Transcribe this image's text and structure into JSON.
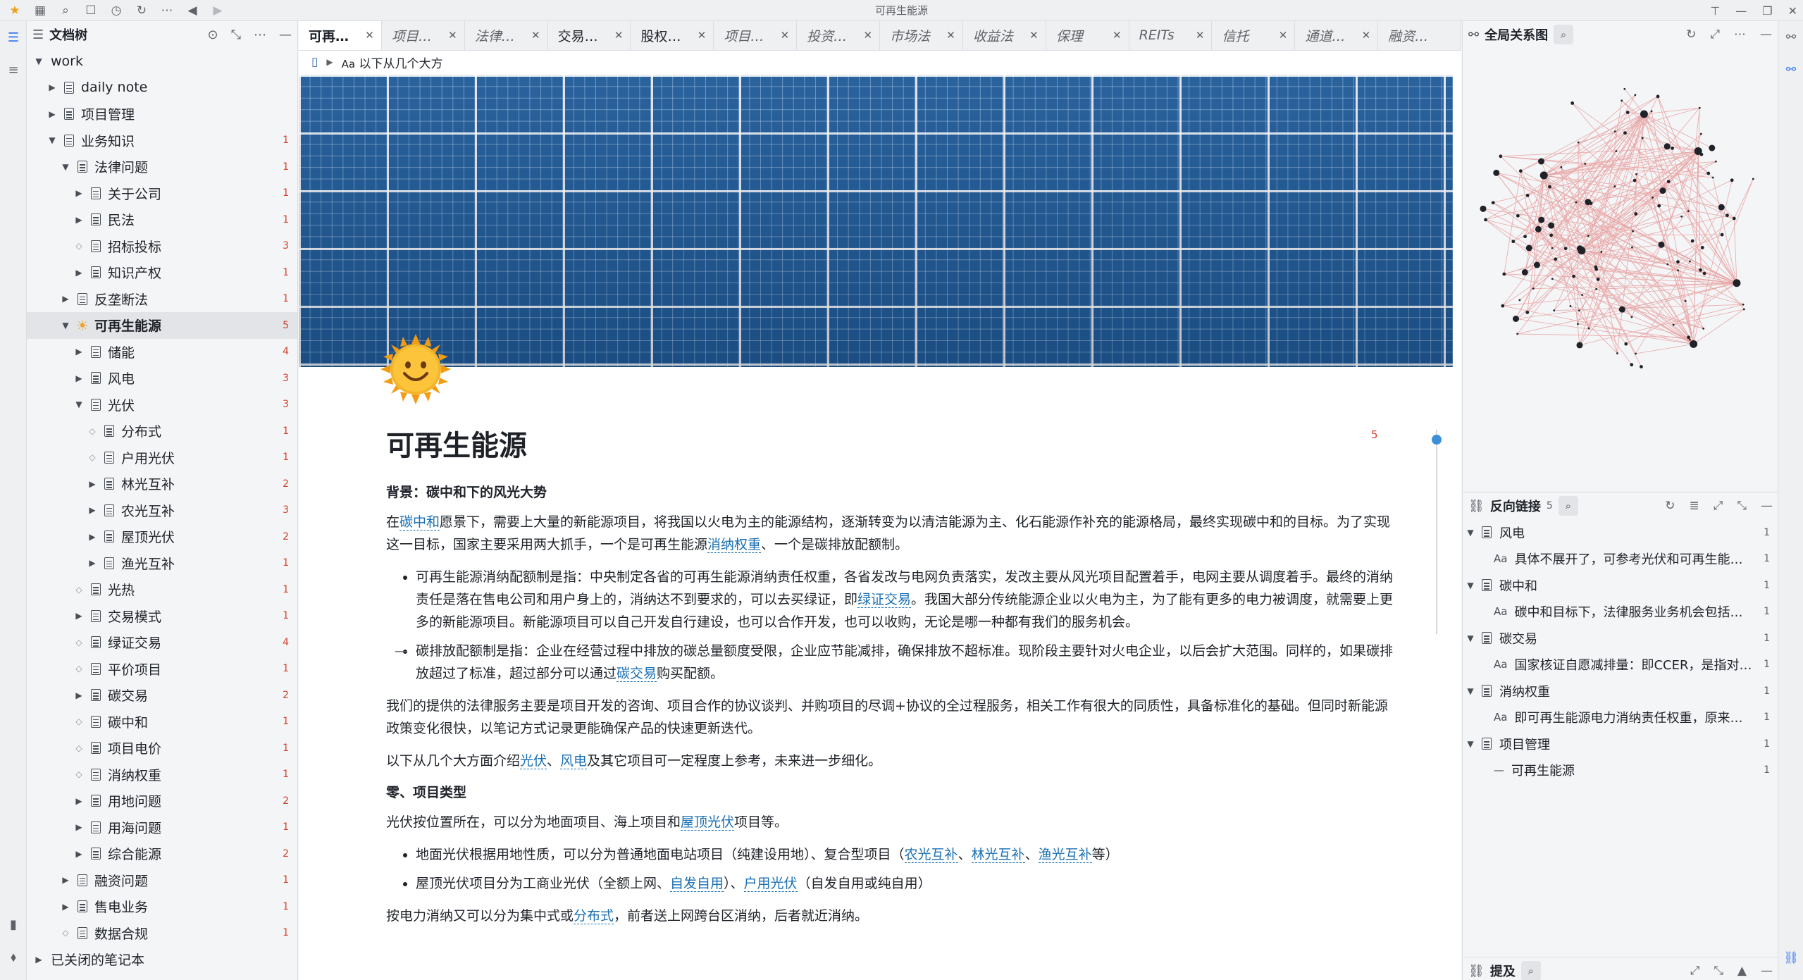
{
  "window": {
    "title": "可再生能源"
  },
  "titlebar_icons": [
    "app-logo-icon",
    "calendar-icon",
    "search-icon",
    "square-icon",
    "history-icon",
    "refresh-icon",
    "more-icon",
    "back-icon",
    "forward-icon"
  ],
  "colors": {
    "accent": "#3575f0",
    "count": "#d2412a",
    "link": "#1a6fb3",
    "banner": "#1f5a98"
  },
  "filetree": {
    "title": "文档树",
    "rows": [
      {
        "label": "work",
        "level": 0,
        "toggle": "open",
        "icon": "none",
        "count": ""
      },
      {
        "label": "daily note",
        "level": 1,
        "toggle": "closed",
        "icon": "doc",
        "count": ""
      },
      {
        "label": "项目管理",
        "level": 1,
        "toggle": "closed",
        "icon": "doc",
        "count": ""
      },
      {
        "label": "业务知识",
        "level": 1,
        "toggle": "open",
        "icon": "doc",
        "count": "1"
      },
      {
        "label": "法律问题",
        "level": 2,
        "toggle": "open",
        "icon": "doc",
        "count": "1"
      },
      {
        "label": "关于公司",
        "level": 3,
        "toggle": "closed",
        "icon": "doc",
        "count": "1"
      },
      {
        "label": "民法",
        "level": 3,
        "toggle": "closed",
        "icon": "doc",
        "count": "1"
      },
      {
        "label": "招标投标",
        "level": 3,
        "toggle": "leaf",
        "icon": "doc",
        "count": "3"
      },
      {
        "label": "知识产权",
        "level": 3,
        "toggle": "closed",
        "icon": "doc",
        "count": "1"
      },
      {
        "label": "反垄断法",
        "level": 2,
        "toggle": "closed",
        "icon": "doc",
        "count": "1"
      },
      {
        "label": "可再生能源",
        "level": 2,
        "toggle": "open",
        "icon": "sun",
        "count": "5",
        "selected": true
      },
      {
        "label": "储能",
        "level": 3,
        "toggle": "closed",
        "icon": "doc",
        "count": "4"
      },
      {
        "label": "风电",
        "level": 3,
        "toggle": "closed",
        "icon": "doc",
        "count": "3"
      },
      {
        "label": "光伏",
        "level": 3,
        "toggle": "open",
        "icon": "doc",
        "count": "3"
      },
      {
        "label": "分布式",
        "level": 4,
        "toggle": "leaf",
        "icon": "doc",
        "count": "1"
      },
      {
        "label": "户用光伏",
        "level": 4,
        "toggle": "leaf",
        "icon": "doc",
        "count": "1"
      },
      {
        "label": "林光互补",
        "level": 4,
        "toggle": "closed",
        "icon": "doc",
        "count": "2"
      },
      {
        "label": "农光互补",
        "level": 4,
        "toggle": "closed",
        "icon": "doc",
        "count": "3"
      },
      {
        "label": "屋顶光伏",
        "level": 4,
        "toggle": "closed",
        "icon": "doc",
        "count": "2"
      },
      {
        "label": "渔光互补",
        "level": 4,
        "toggle": "closed",
        "icon": "doc",
        "count": "1"
      },
      {
        "label": "光热",
        "level": 3,
        "toggle": "leaf",
        "icon": "doc",
        "count": "1"
      },
      {
        "label": "交易模式",
        "level": 3,
        "toggle": "closed",
        "icon": "doc",
        "count": "1"
      },
      {
        "label": "绿证交易",
        "level": 3,
        "toggle": "leaf",
        "icon": "doc",
        "count": "4"
      },
      {
        "label": "平价项目",
        "level": 3,
        "toggle": "leaf",
        "icon": "doc",
        "count": "1"
      },
      {
        "label": "碳交易",
        "level": 3,
        "toggle": "closed",
        "icon": "doc",
        "count": "2"
      },
      {
        "label": "碳中和",
        "level": 3,
        "toggle": "leaf",
        "icon": "doc",
        "count": "1"
      },
      {
        "label": "项目电价",
        "level": 3,
        "toggle": "leaf",
        "icon": "doc",
        "count": "1"
      },
      {
        "label": "消纳权重",
        "level": 3,
        "toggle": "leaf",
        "icon": "doc",
        "count": "1"
      },
      {
        "label": "用地问题",
        "level": 3,
        "toggle": "closed",
        "icon": "doc",
        "count": "2"
      },
      {
        "label": "用海问题",
        "level": 3,
        "toggle": "closed",
        "icon": "doc",
        "count": "1"
      },
      {
        "label": "综合能源",
        "level": 3,
        "toggle": "closed",
        "icon": "doc",
        "count": "2"
      },
      {
        "label": "融资问题",
        "level": 2,
        "toggle": "closed",
        "icon": "doc",
        "count": "1"
      },
      {
        "label": "售电业务",
        "level": 2,
        "toggle": "closed",
        "icon": "doc",
        "count": "1"
      },
      {
        "label": "数据合规",
        "level": 2,
        "toggle": "leaf",
        "icon": "doc",
        "count": "1"
      },
      {
        "label": "已关闭的笔记本",
        "level": 0,
        "toggle": "closed",
        "icon": "none",
        "count": ""
      }
    ]
  },
  "tabs": [
    {
      "label": "可再…",
      "active": true,
      "italic": false
    },
    {
      "label": "项目…",
      "active": false,
      "italic": true
    },
    {
      "label": "法律…",
      "active": false,
      "italic": true
    },
    {
      "label": "交易…",
      "active": false,
      "italic": false
    },
    {
      "label": "股权…",
      "active": false,
      "italic": false
    },
    {
      "label": "项目…",
      "active": false,
      "italic": true
    },
    {
      "label": "投资…",
      "active": false,
      "italic": true
    },
    {
      "label": "市场法",
      "active": false,
      "italic": true
    },
    {
      "label": "收益法",
      "active": false,
      "italic": true
    },
    {
      "label": "保理",
      "active": false,
      "italic": true
    },
    {
      "label": "REITs",
      "active": false,
      "italic": true
    },
    {
      "label": "信托",
      "active": false,
      "italic": true
    },
    {
      "label": "通道…",
      "active": false,
      "italic": true
    },
    {
      "label": "融资…",
      "active": false,
      "italic": true
    }
  ],
  "breadcrumb": {
    "text": "以下从几个大方",
    "prefix": "Aa"
  },
  "doc": {
    "title": "可再生能源",
    "backlink_count": "5",
    "bg_heading": "背景：碳中和下的风光大势",
    "p1": {
      "a": "在",
      "l1": "碳中和",
      "b": "愿景下，需要上大量的新能源项目，将我国以火电为主的能源结构，逐渐转变为以清洁能源为主、化石能源作补充的能源格局，最终实现碳中和的目标。为了实现这一目标，国家主要采用两大抓手，一个是可再生能源",
      "l2": "消纳权重",
      "c": "、一个是碳排放配额制。"
    },
    "li1": {
      "a": "可再生能源消纳配额制是指：中央制定各省的可再生能源消纳责任权重，各省发改与电网负责落实，发改主要从风光项目配置着手，电网主要从调度着手。最终的消纳责任是落在售电公司和用户身上的，消纳达不到要求的，可以去买绿证，即",
      "l1": "绿证交易",
      "b": "。我国大部分传统能源企业以火电为主，为了能有更多的电力被调度，就需要上更多的新能源项目。新能源项目可以自己开发自行建设，也可以合作开发，也可以收购，无论是哪一种都有我们的服务机会。"
    },
    "li2": {
      "a": "碳排放配额制是指：企业在经营过程中排放的碳总量额度受限，企业应节能减排，确保排放不超标准。现阶段主要针对火电企业，以后会扩大范围。同样的，如果碳排放超过了标准，超过部分可以通过",
      "l1": "碳交易",
      "b": "购买配额。"
    },
    "p2": "我们的提供的法律服务主要是项目开发的咨询、项目合作的协议谈判、并购项目的尽调+协议的全过程服务，相关工作有很大的同质性，具备标准化的基础。但同时新能源政策变化很快，以笔记方式记录更能确保产品的快速更新迭代。",
    "p3": {
      "a": "以下从几个大方面介绍",
      "l1": "光伏",
      "b": "、",
      "l2": "风电",
      "c": "及其它项目可一定程度上参考，未来进一步细化。"
    },
    "h_types": "零、项目类型",
    "p4": {
      "a": "光伏按位置所在，可以分为地面项目、海上项目和",
      "l1": "屋顶光伏",
      "b": "项目等。"
    },
    "li3": {
      "a": "地面光伏根据用地性质，可以分为普通地面电站项目（纯建设用地）、复合型项目（",
      "l1": "农光互补",
      "b": "、",
      "l2": "林光互补",
      "c": "、",
      "l3": "渔光互补",
      "d": "等）"
    },
    "li4": {
      "a": "屋顶光伏项目分为工商业光伏（全额上网、",
      "l1": "自发自用",
      "b": "）、",
      "l2": "户用光伏",
      "c": "（自发自用或纯自用）"
    },
    "p5": {
      "a": "按电力消纳又可以分为集中式或",
      "l1": "分布式",
      "b": "，前者送上网跨台区消纳，后者就近消纳。"
    }
  },
  "graph_panel": {
    "title": "全局关系图"
  },
  "backlinks_panel": {
    "title": "反向链接",
    "count": "5",
    "groups": [
      {
        "label": "风电",
        "count": "1",
        "snippet": "具体不展开了，可参考光伏和可再生能…",
        "snippet_icon": "Aa"
      },
      {
        "label": "碳中和",
        "count": "1",
        "snippet": "碳中和目标下，法律服务业务机会包括…",
        "snippet_icon": "Aa"
      },
      {
        "label": "碳交易",
        "count": "1",
        "snippet": "国家核证自愿减排量：即CCER，是指对…",
        "snippet_icon": "Aa"
      },
      {
        "label": "消纳权重",
        "count": "1",
        "snippet": "即可再生能源电力消纳责任权重，原来…",
        "snippet_icon": "Aa"
      },
      {
        "label": "项目管理",
        "count": "1",
        "snippet": "可再生能源",
        "snippet_icon": "—"
      }
    ]
  },
  "mentions_panel": {
    "title": "提及"
  }
}
